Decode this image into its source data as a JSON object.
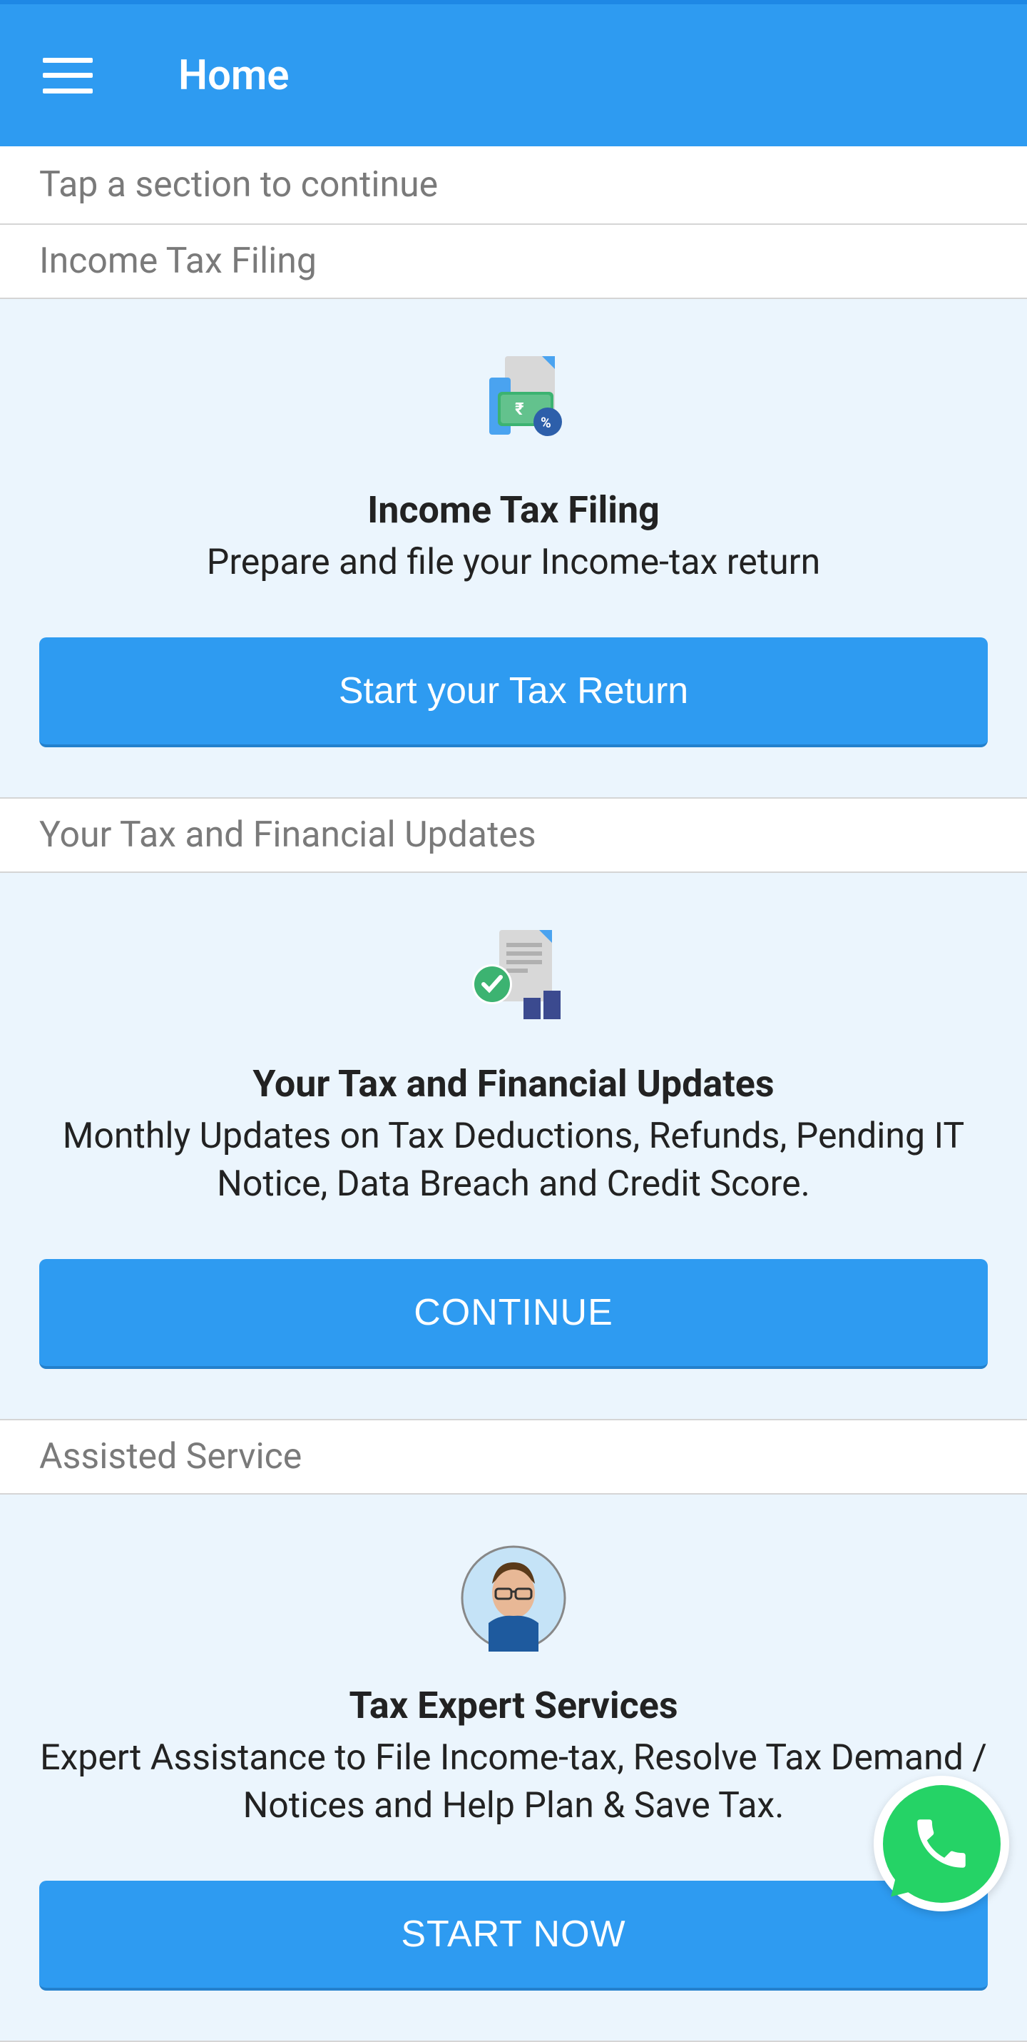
{
  "header": {
    "title": "Home"
  },
  "subheader": "Tap a section to continue",
  "sections": {
    "filing": {
      "label": "Income Tax Filing",
      "card_title": "Income Tax Filing",
      "card_desc": "Prepare and file your Income-tax return",
      "button": "Start your Tax Return"
    },
    "updates": {
      "label": "Your Tax and Financial Updates",
      "card_title": "Your Tax and Financial Updates",
      "card_desc": "Monthly Updates on Tax Deductions, Refunds, Pending IT Notice, Data Breach and Credit Score.",
      "button": "CONTINUE"
    },
    "assisted": {
      "label": "Assisted Service",
      "card_title": "Tax Expert Services",
      "card_desc": "Expert Assistance to File Income-tax, Resolve Tax Demand / Notices and Help Plan & Save Tax.",
      "button": "START NOW"
    }
  }
}
